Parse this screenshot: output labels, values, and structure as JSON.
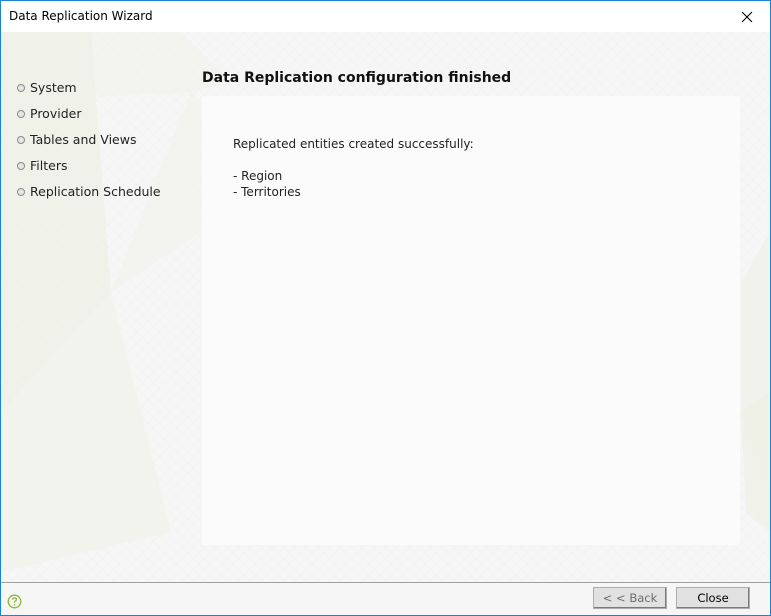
{
  "window": {
    "title": "Data Replication Wizard",
    "close_icon": "close-icon",
    "border_color": "#1883d7"
  },
  "steps": [
    {
      "label": "System",
      "icon": "bullet-dot-icon"
    },
    {
      "label": "Provider",
      "icon": "bullet-dot-icon"
    },
    {
      "label": "Tables and Views",
      "icon": "bullet-dot-icon"
    },
    {
      "label": "Filters",
      "icon": "bullet-dot-icon"
    },
    {
      "label": "Replication Schedule",
      "icon": "bullet-dot-icon"
    }
  ],
  "main": {
    "heading": "Data Replication configuration finished",
    "message": "Replicated entities created successfully:",
    "entities": [
      "- Region",
      "- Territories"
    ]
  },
  "footer": {
    "help_icon": "help-icon",
    "help_color": "#8cb63c",
    "back_label": "< < Back",
    "back_enabled": false,
    "close_label": "Close"
  }
}
